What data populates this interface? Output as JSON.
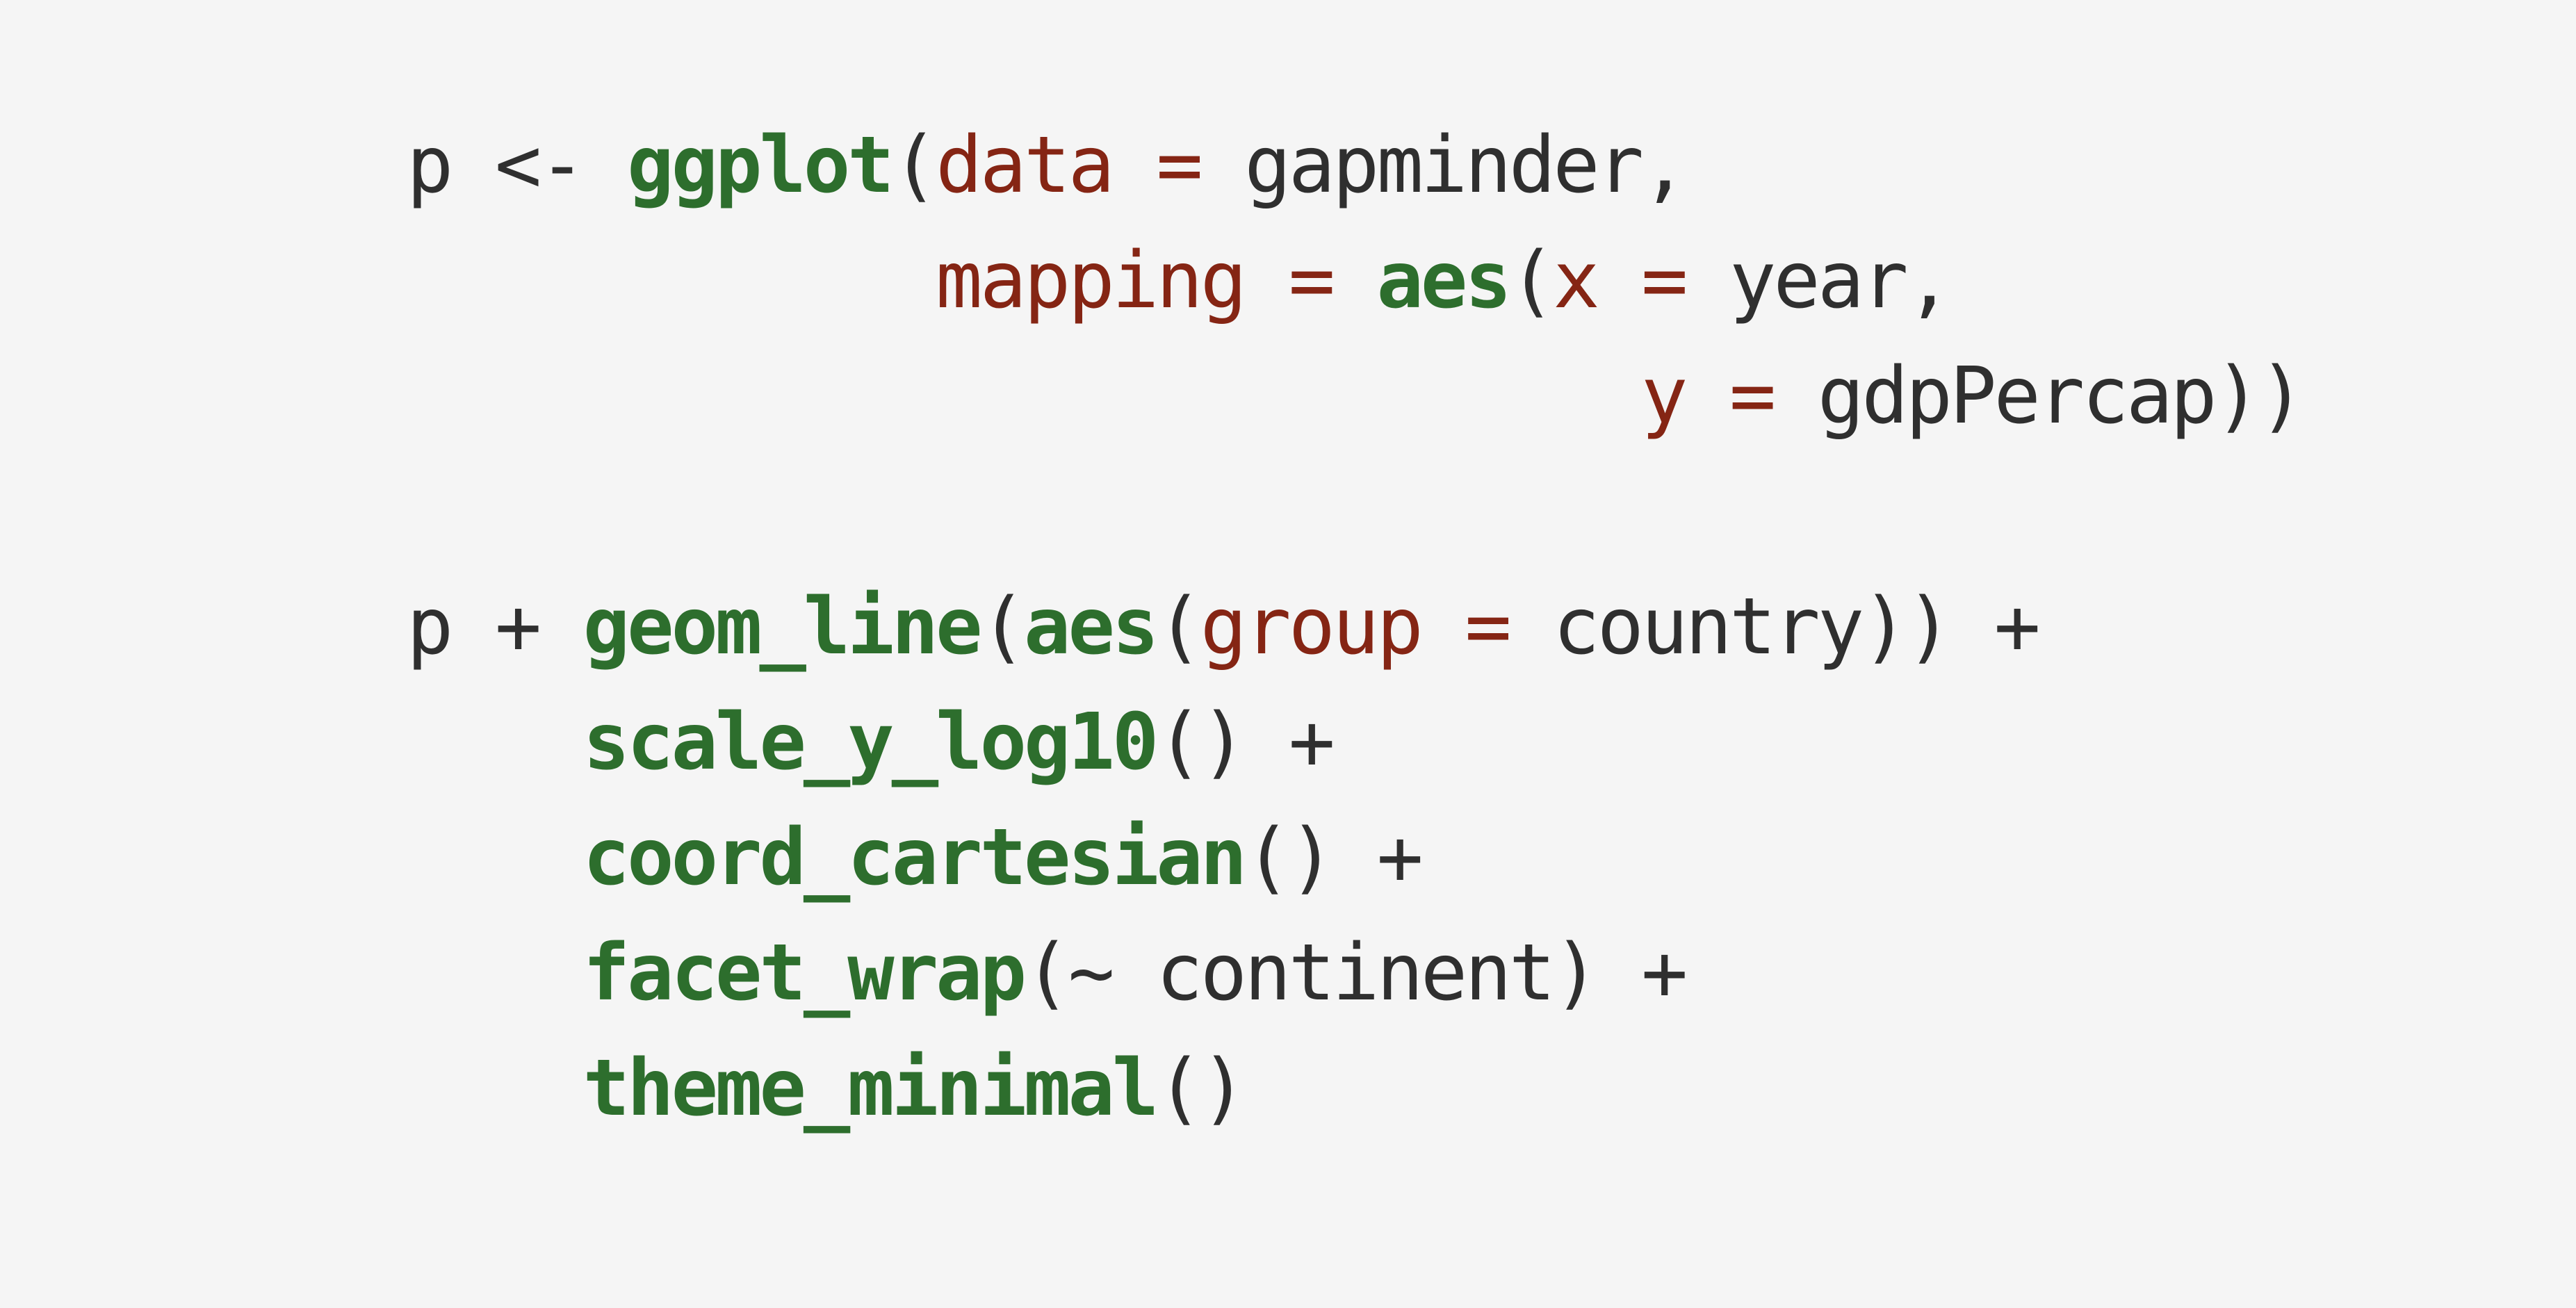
{
  "colors": {
    "background": "#f5f5f5",
    "plain_text": "#2f2f2f",
    "function_name": "#2d6e2d",
    "argument_name": "#852514"
  },
  "code": {
    "language": "R",
    "lines": [
      {
        "tokens": [
          {
            "text": "p <- ",
            "kind": "plain"
          },
          {
            "text": "ggplot",
            "kind": "fn"
          },
          {
            "text": "(",
            "kind": "plain"
          },
          {
            "text": "data",
            "kind": "arg"
          },
          {
            "text": " = ",
            "kind": "op"
          },
          {
            "text": "gapminder,",
            "kind": "plain"
          }
        ]
      },
      {
        "tokens": [
          {
            "text": "            ",
            "kind": "plain"
          },
          {
            "text": "mapping",
            "kind": "arg"
          },
          {
            "text": " = ",
            "kind": "op"
          },
          {
            "text": "aes",
            "kind": "fn"
          },
          {
            "text": "(",
            "kind": "plain"
          },
          {
            "text": "x",
            "kind": "arg"
          },
          {
            "text": " = ",
            "kind": "op"
          },
          {
            "text": "year,",
            "kind": "plain"
          }
        ]
      },
      {
        "tokens": [
          {
            "text": "                            ",
            "kind": "plain"
          },
          {
            "text": "y",
            "kind": "arg"
          },
          {
            "text": " = ",
            "kind": "op"
          },
          {
            "text": "gdpPercap))",
            "kind": "plain"
          }
        ]
      },
      {
        "tokens": []
      },
      {
        "tokens": [
          {
            "text": "p + ",
            "kind": "plain"
          },
          {
            "text": "geom_line",
            "kind": "fn"
          },
          {
            "text": "(",
            "kind": "plain"
          },
          {
            "text": "aes",
            "kind": "fn"
          },
          {
            "text": "(",
            "kind": "plain"
          },
          {
            "text": "group",
            "kind": "arg"
          },
          {
            "text": " = ",
            "kind": "op"
          },
          {
            "text": "country)) +",
            "kind": "plain"
          }
        ]
      },
      {
        "tokens": [
          {
            "text": "    ",
            "kind": "plain"
          },
          {
            "text": "scale_y_log10",
            "kind": "fn"
          },
          {
            "text": "() +",
            "kind": "plain"
          }
        ]
      },
      {
        "tokens": [
          {
            "text": "    ",
            "kind": "plain"
          },
          {
            "text": "coord_cartesian",
            "kind": "fn"
          },
          {
            "text": "() +",
            "kind": "plain"
          }
        ]
      },
      {
        "tokens": [
          {
            "text": "    ",
            "kind": "plain"
          },
          {
            "text": "facet_wrap",
            "kind": "fn"
          },
          {
            "text": "(~ continent) +",
            "kind": "plain"
          }
        ]
      },
      {
        "tokens": [
          {
            "text": "    ",
            "kind": "plain"
          },
          {
            "text": "theme_minimal",
            "kind": "fn"
          },
          {
            "text": "()",
            "kind": "plain"
          }
        ]
      }
    ]
  }
}
